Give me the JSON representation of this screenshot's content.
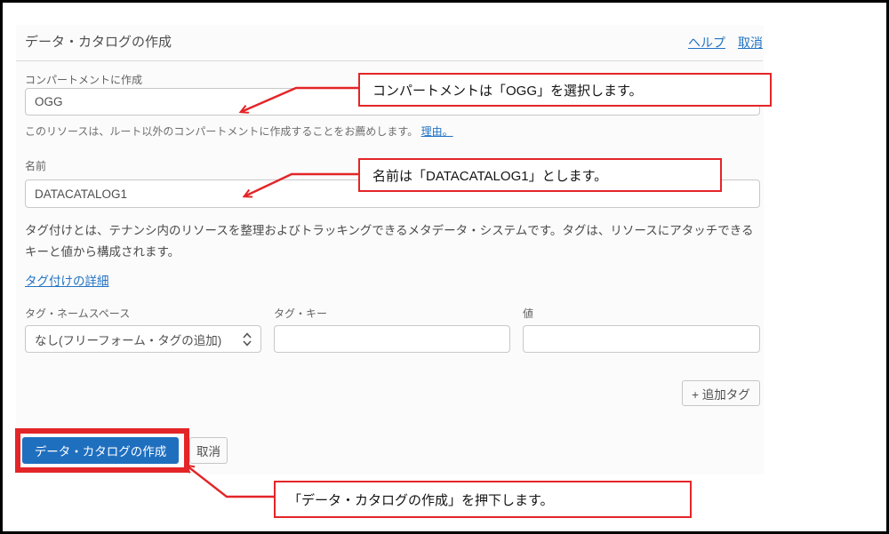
{
  "panel": {
    "title": "データ・カタログの作成",
    "header_links": {
      "help": "ヘルプ",
      "cancel": "取消"
    }
  },
  "compartment": {
    "label": "コンパートメントに作成",
    "selected_value": "OGG",
    "helper_text": "このリソースは、ルート以外のコンパートメントに作成することをお薦めします。",
    "helper_link": "理由。"
  },
  "name_field": {
    "label": "名前",
    "value": "DATACATALOG1"
  },
  "tags": {
    "description": "タグ付けとは、テナンシ内のリソースを整理およびトラッキングできるメタデータ・システムです。タグは、リソースにアタッチできるキーと値から構成されます。",
    "details_link": "タグ付けの詳細",
    "namespace_label": "タグ・ネームスペース",
    "namespace_value": "なし(フリーフォーム・タグの追加)",
    "key_label": "タグ・キー",
    "value_label": "値",
    "add_tag_button": "+ 追加タグ"
  },
  "footer": {
    "create_button": "データ・カタログの作成",
    "cancel_button": "取消"
  },
  "annotations": {
    "compartment_note": "コンパートメントは「OGG」を選択します。",
    "name_note": "名前は「DATACATALOG1」とします。",
    "create_note": "「データ・カタログの作成」を押下します。"
  },
  "colors": {
    "accent_red": "#e42528",
    "primary_blue": "#1f6fbf",
    "link_blue": "#2273c3"
  }
}
